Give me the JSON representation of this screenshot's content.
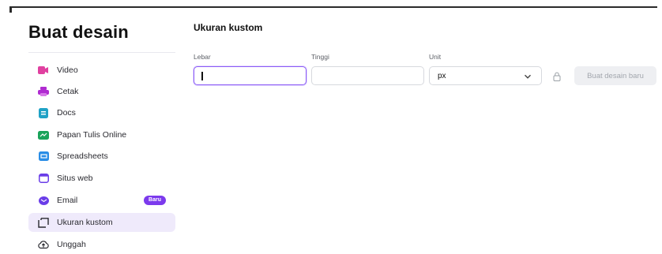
{
  "sidebar": {
    "title": "Buat desain",
    "items": [
      {
        "label": "Video",
        "icon": "video-icon",
        "color": "#e040a0"
      },
      {
        "label": "Cetak",
        "icon": "printer-icon",
        "color": "#b02bd1"
      },
      {
        "label": "Docs",
        "icon": "docs-icon",
        "color": "#1fa2c6"
      },
      {
        "label": "Papan Tulis Online",
        "icon": "whiteboard-icon",
        "color": "#1aa35a"
      },
      {
        "label": "Spreadsheets",
        "icon": "spreadsheet-icon",
        "color": "#2a8de6"
      },
      {
        "label": "Situs web",
        "icon": "website-icon",
        "color": "#6a3de8"
      },
      {
        "label": "Email",
        "icon": "email-icon",
        "color": "#6a3de8",
        "badge": "Baru"
      },
      {
        "label": "Ukuran kustom",
        "icon": "custom-size-icon",
        "color": "#2a2a30",
        "active": true
      },
      {
        "label": "Unggah",
        "icon": "upload-icon",
        "color": "#2a2a30"
      }
    ]
  },
  "main": {
    "title": "Ukuran kustom",
    "width": {
      "label": "Lebar",
      "value": ""
    },
    "height": {
      "label": "Tinggi",
      "value": ""
    },
    "unit": {
      "label": "Unit",
      "value": "px"
    },
    "create_button": "Buat desain baru"
  }
}
